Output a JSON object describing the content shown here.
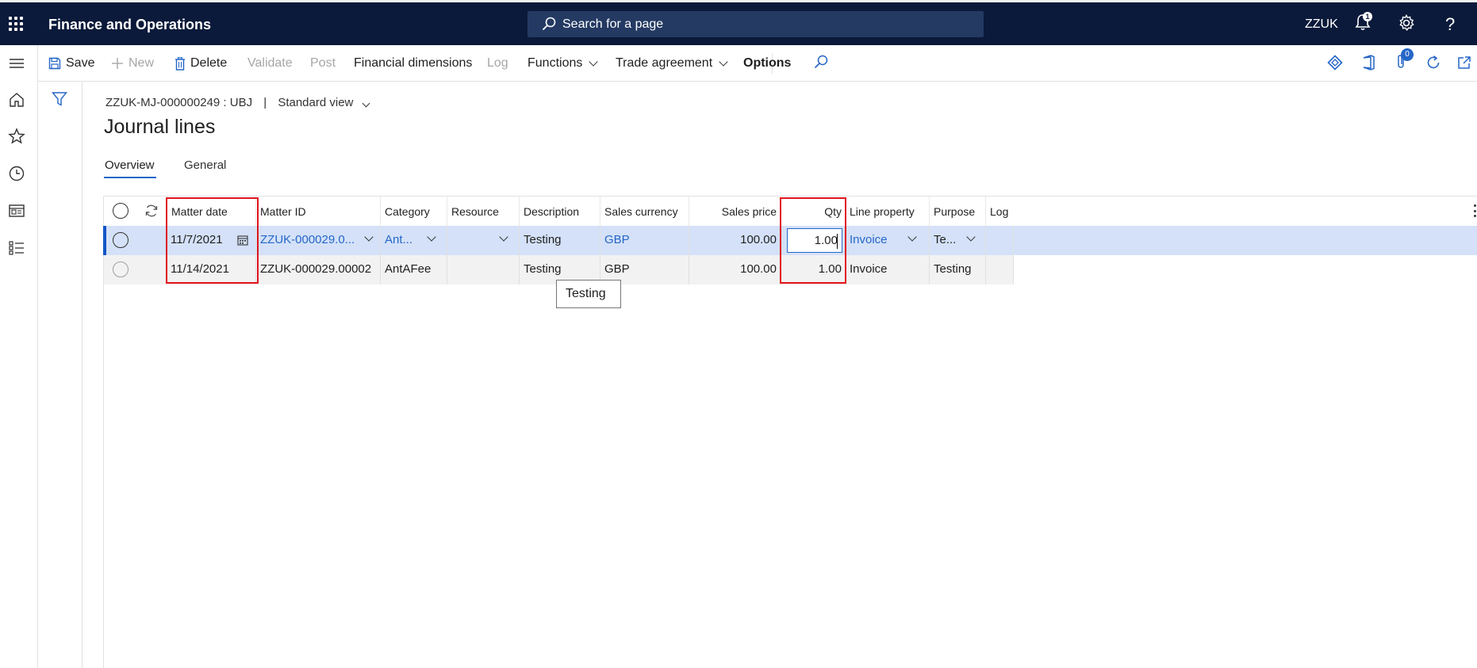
{
  "topbar": {
    "app_title": "Finance and Operations",
    "search_placeholder": "Search for a page",
    "company": "ZZUK",
    "notification_count": "1",
    "help_label": "?"
  },
  "actions": {
    "save": "Save",
    "new": "New",
    "delete": "Delete",
    "validate": "Validate",
    "post": "Post",
    "financial_dimensions": "Financial dimensions",
    "log": "Log",
    "functions": "Functions",
    "trade_agreement": "Trade agreement",
    "options": "Options",
    "attachments_count": "0"
  },
  "page": {
    "record": "ZZUK-MJ-000000249 : UBJ",
    "separator": "|",
    "view": "Standard view",
    "title": "Journal lines",
    "tabs": [
      "Overview",
      "General"
    ]
  },
  "grid": {
    "headers": {
      "matter_date": "Matter date",
      "matter_id": "Matter ID",
      "category": "Category",
      "resource": "Resource",
      "description": "Description",
      "sales_currency": "Sales currency",
      "sales_price": "Sales price",
      "qty": "Qty",
      "line_property": "Line property",
      "purpose": "Purpose",
      "log": "Log"
    },
    "rows": [
      {
        "matter_date": "11/7/2021",
        "matter_id": "ZZUK-000029.0...",
        "category": "Ant...",
        "resource": "",
        "description": "Testing",
        "sales_currency": "GBP",
        "sales_price": "100.00",
        "qty": "1.00",
        "line_property": "Invoice",
        "purpose": "Te..."
      },
      {
        "matter_date": "11/14/2021",
        "matter_id": "ZZUK-000029.00002",
        "category": "AntAFee",
        "resource": "",
        "description": "Testing",
        "sales_currency": "GBP",
        "sales_price": "100.00",
        "qty": "1.00",
        "line_property": "Invoice",
        "purpose": "Testing"
      }
    ]
  },
  "tooltip": "Testing",
  "colors": {
    "topbar_bg": "#0b1a3a",
    "accent": "#2566c7",
    "highlight_box": "#e0131b",
    "selected_row": "#d4e1f8"
  }
}
